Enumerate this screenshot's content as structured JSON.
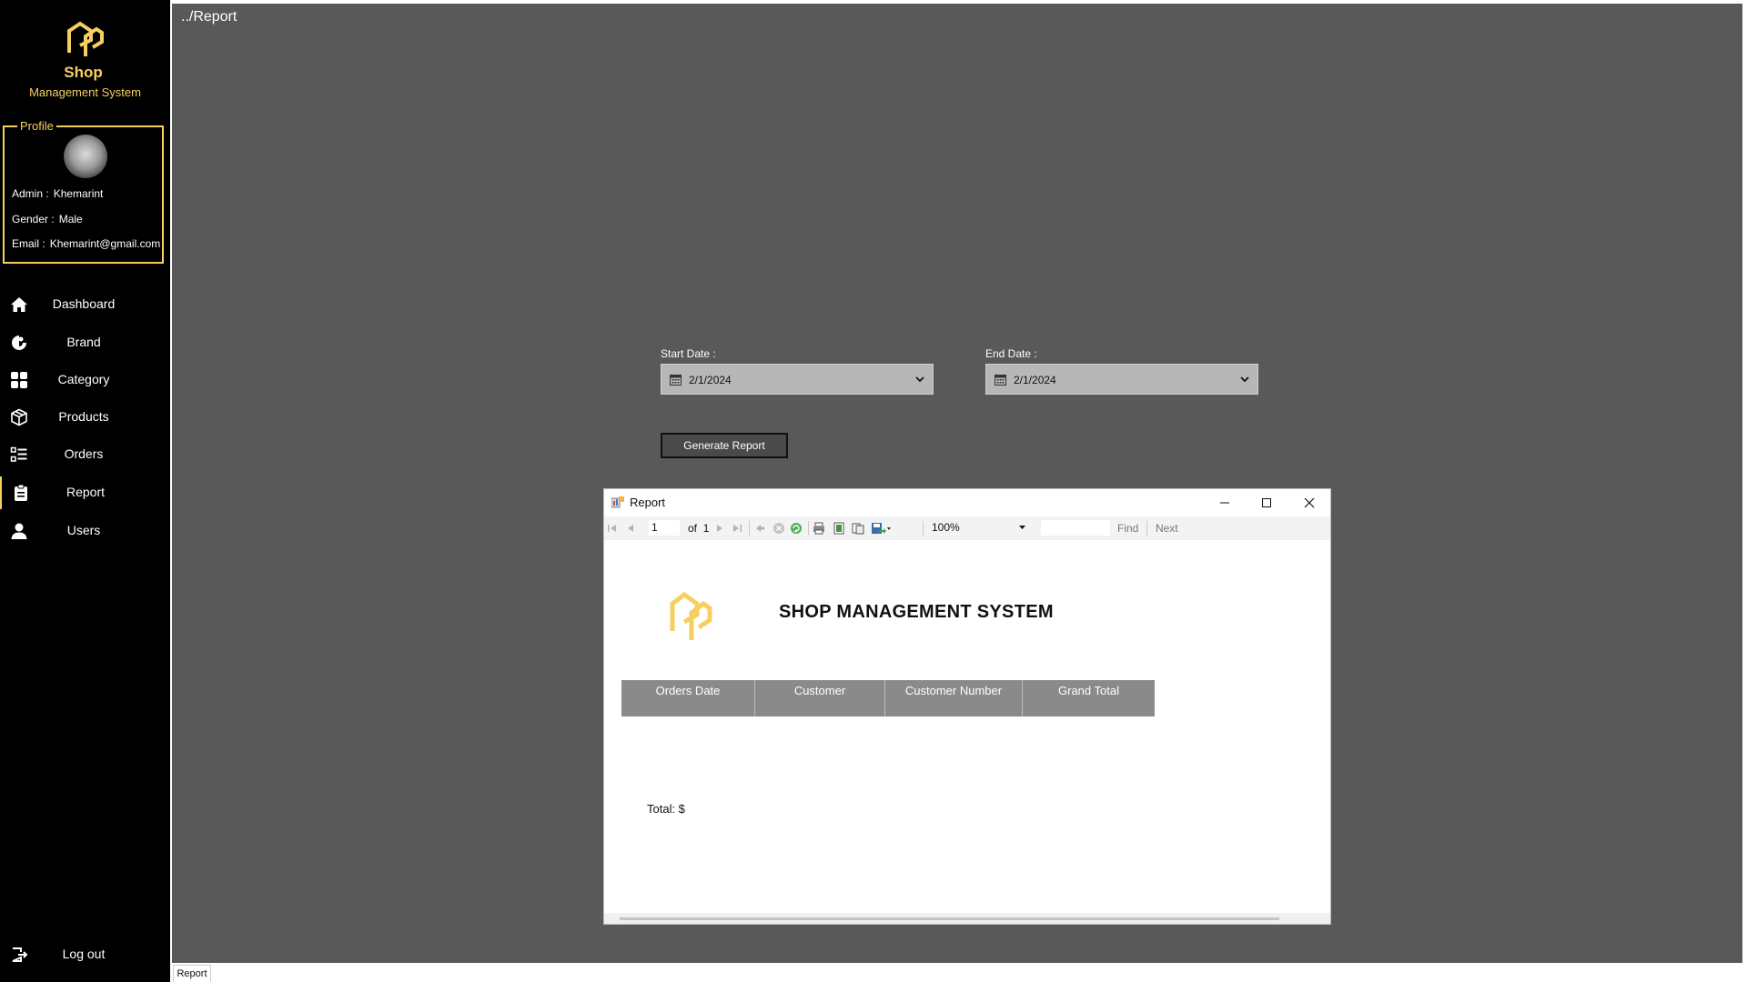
{
  "sidebar": {
    "brand_title": "Shop",
    "brand_subtitle": "Management System",
    "profile": {
      "legend": "Profile",
      "admin_label": "Admin :",
      "admin_value": "Khemarint",
      "gender_label": "Gender :",
      "gender_value": "Male",
      "email_label": "Email :",
      "email_value": "Khemarint@gmail.com"
    },
    "nav": [
      {
        "label": "Dashboard",
        "icon": "home-icon"
      },
      {
        "label": "Brand",
        "icon": "brand-icon"
      },
      {
        "label": "Category",
        "icon": "grid-icon"
      },
      {
        "label": "Products",
        "icon": "box-icon"
      },
      {
        "label": "Orders",
        "icon": "list-icon"
      },
      {
        "label": "Report",
        "icon": "clipboard-icon",
        "active": true
      },
      {
        "label": "Users",
        "icon": "user-icon"
      }
    ],
    "logout_label": "Log out"
  },
  "main": {
    "breadcrumb": "../Report",
    "start_date": {
      "label": "Start Date :",
      "value": "2/1/2024"
    },
    "end_date": {
      "label": "End Date :",
      "value": "2/1/2024"
    },
    "generate_label": "Generate Report"
  },
  "report_window": {
    "title": "Report",
    "toolbar": {
      "page": "1",
      "of_label": "of",
      "total_pages": "1",
      "zoom": "100%",
      "find_label": "Find",
      "next_label": "Next"
    },
    "report": {
      "heading": "SHOP MANAGEMENT SYSTEM",
      "columns": [
        "Orders Date",
        "Customer",
        "Customer Number",
        "Grand Total"
      ],
      "total_label": "Total: $"
    }
  },
  "bottom_tab": "Report",
  "colors": {
    "accent": "#F5D061",
    "sidebar_bg": "#000000",
    "main_bg": "#595959",
    "table_header": "#8a8a8a"
  }
}
